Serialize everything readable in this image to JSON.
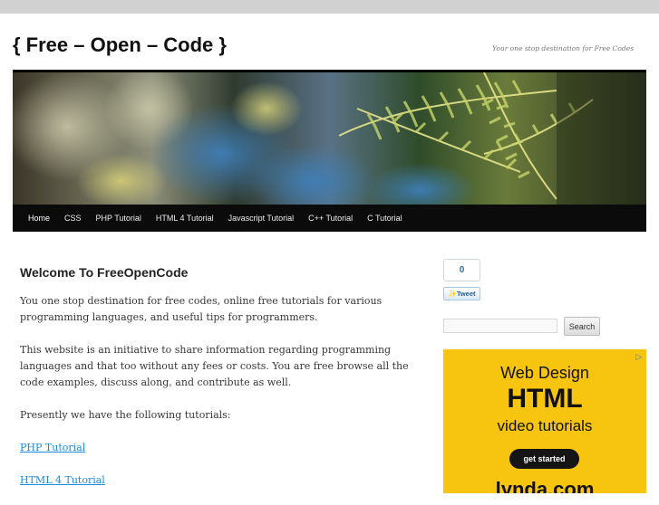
{
  "site": {
    "title": "{ Free – Open – Code }",
    "tagline": "Your one stop destination for Free Codes"
  },
  "nav": {
    "items": [
      {
        "label": "Home"
      },
      {
        "label": "CSS"
      },
      {
        "label": "PHP Tutorial"
      },
      {
        "label": "HTML 4 Tutorial"
      },
      {
        "label": "Javascript Tutorial"
      },
      {
        "label": "C++ Tutorial"
      },
      {
        "label": "C Tutorial"
      }
    ]
  },
  "article": {
    "title": "Welcome To FreeOpenCode",
    "paragraphs": [
      "You one stop destination for free codes, online free tutorials for various programming languages, and useful tips for programmers.",
      "This website is an initiative to share information regarding programming languages and that too without any fees or costs. You are free browse all the code examples, discuss along, and contribute as well.",
      "Presently we have the following tutorials:"
    ],
    "links": [
      "PHP Tutorial",
      "HTML 4 Tutorial"
    ]
  },
  "sidebar": {
    "tweet": {
      "count": "0",
      "label": "Tweet"
    },
    "search": {
      "placeholder": "",
      "button_label": "Search"
    },
    "ad": {
      "line1": "Web Design",
      "line2": "HTML",
      "line3": "video tutorials",
      "cta": "get started",
      "brand": "lynda.com",
      "info_icon": "ad-choices-icon",
      "background": "#f7c410"
    }
  },
  "colors": {
    "nav_bg": "#0b0b0b",
    "link": "#1b8be0",
    "top_bar": "#d1d1d1"
  }
}
